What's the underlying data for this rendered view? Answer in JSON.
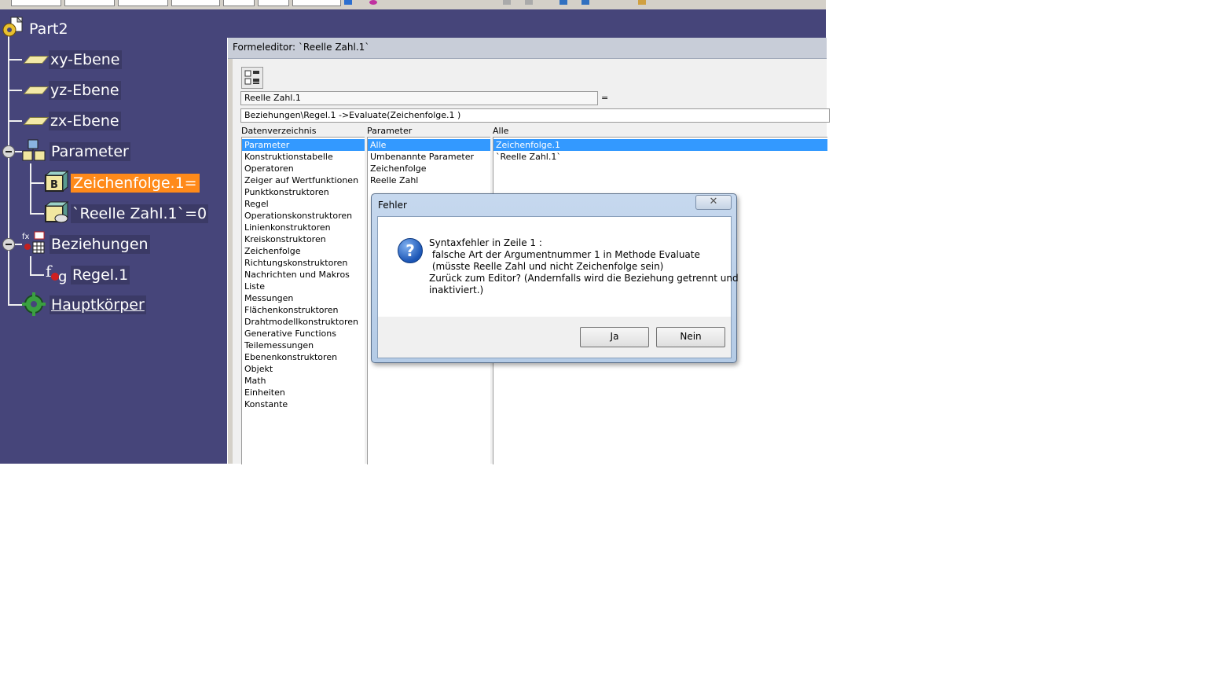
{
  "tree": {
    "root": "Part2",
    "planes": [
      "xy-Ebene",
      "yz-Ebene",
      "zx-Ebene"
    ],
    "parameter": "Parameter",
    "param_items": [
      "Zeichenfolge.1=",
      "`Reelle Zahl.1`=0"
    ],
    "relations": "Beziehungen",
    "relation_items": [
      "Regel.1"
    ],
    "body": "Hauptkörper"
  },
  "formula_editor": {
    "title": "Formeleditor: `Reelle Zahl.1`",
    "target_field": "Reelle Zahl.1",
    "equals": "=",
    "formula_field": "Beziehungen\\Regel.1 ->Evaluate(Zeichenfolge.1 )",
    "col1_header": "Datenverzeichnis",
    "col2_header": "Parameter",
    "col3_header": "Alle",
    "col1_items": [
      "Parameter",
      "Konstruktionstabelle",
      "Operatoren",
      "Zeiger auf Wertfunktionen",
      "Punktkonstruktoren",
      "Regel",
      "Operationskonstruktoren",
      "Linienkonstruktoren",
      "Kreiskonstruktoren",
      "Zeichenfolge",
      "Richtungskonstruktoren",
      "Nachrichten und Makros",
      "Liste",
      "Messungen",
      "Flächenkonstruktoren",
      "Drahtmodellkonstruktoren",
      "Generative Functions",
      "Teilemessungen",
      "Ebenenkonstruktoren",
      "Objekt",
      "Math",
      "Einheiten",
      "Konstante"
    ],
    "col2_items": [
      "Alle",
      "Umbenannte Parameter",
      "Zeichenfolge",
      "Reelle Zahl"
    ],
    "col3_items": [
      "Zeichenfolge.1",
      "`Reelle Zahl.1`"
    ]
  },
  "dialog": {
    "title": "Fehler",
    "close": "✕",
    "message": "Syntaxfehler in Zeile 1 :\n falsche Art der Argumentnummer 1 in Methode Evaluate\n (müsste Reelle Zahl und nicht Zeichenfolge sein)\nZurück zum Editor? (Andernfalls wird die Beziehung getrennt und\ninaktiviert.)",
    "yes": "Ja",
    "no": "Nein"
  },
  "colors": {
    "tree_bg": "#46457a",
    "selection": "#ff8a1a",
    "list_selection": "#3399ff"
  }
}
